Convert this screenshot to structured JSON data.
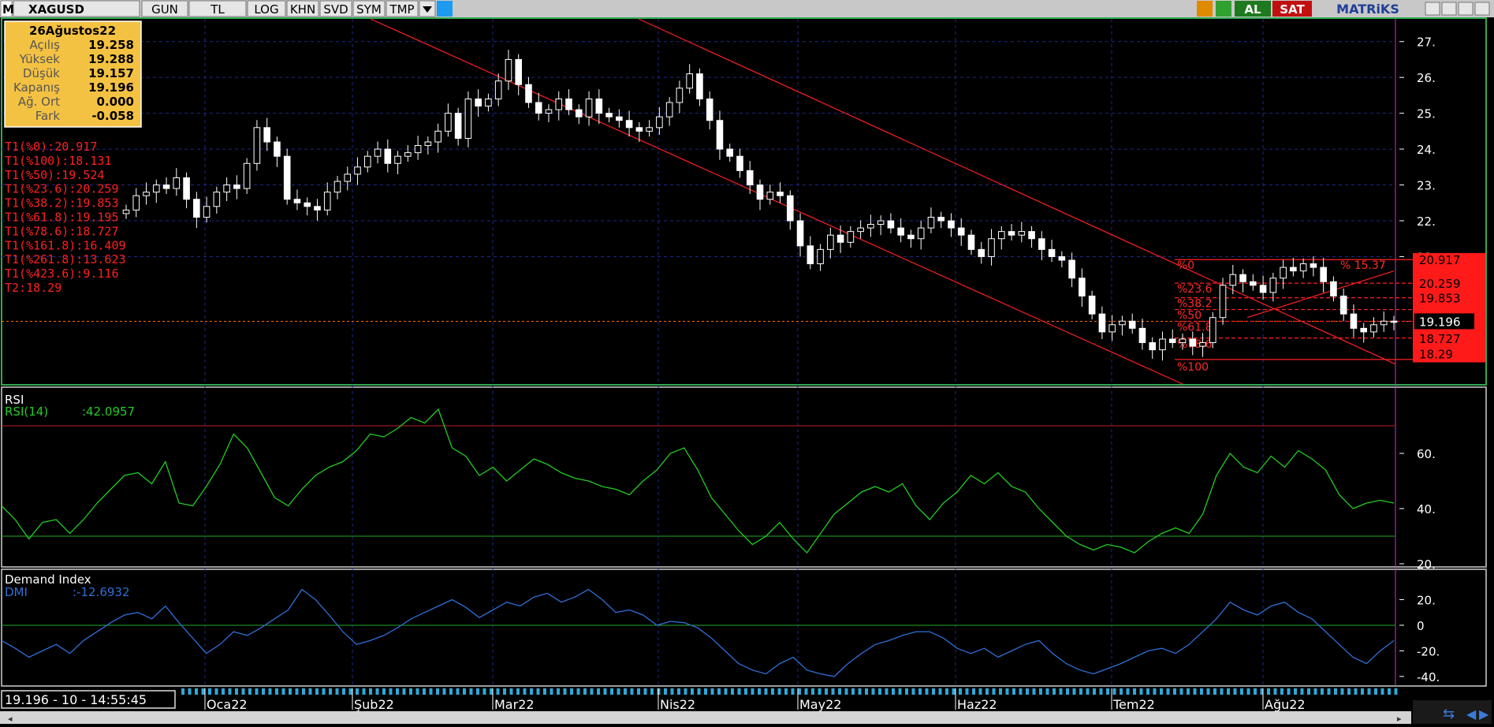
{
  "toolbar": {
    "symbol": "XAGUSD",
    "buttons": [
      "GUN",
      "TL",
      "LOG",
      "KHN",
      "SVD",
      "SYM",
      "TMP"
    ],
    "al": "AL",
    "sat": "SAT",
    "brand": "MATRiKS"
  },
  "ohlc_box": {
    "date": "26Ağustos22",
    "rows": [
      {
        "label": "Açılış",
        "value": "19.258"
      },
      {
        "label": "Yüksek",
        "value": "19.288"
      },
      {
        "label": "Düşük",
        "value": "19.157"
      },
      {
        "label": "Kapanış",
        "value": "19.196"
      },
      {
        "label": "Ağ. Ort",
        "value": "0.000"
      },
      {
        "label": "Fark",
        "value": "-0.058"
      }
    ]
  },
  "fib_legend": [
    "T1(%0):20.917",
    "T1(%100):18.131",
    "T1(%50):19.524",
    "T1(%23.6):20.259",
    "T1(%38.2):19.853",
    "T1(%61.8):19.195",
    "T1(%78.6):18.727",
    "T1(%161.8):16.409",
    "T1(%261.8):13.623",
    "T1(%423.6):9.116",
    "T2:18.29"
  ],
  "status_text": "19.196 - 10 - 14:55:45",
  "colors": {
    "up": "#ffffff",
    "down": "#ffffff",
    "rsi": "#22cc22",
    "dmi": "#2f6fd8",
    "trend": "#ff2020",
    "grid": "#1c2a88"
  },
  "chart_data": [
    {
      "type": "candlestick",
      "symbol": "XAGUSD",
      "y_ticks": [
        "27.",
        "26.",
        "25.",
        "24.",
        "23.",
        "22.",
        "21.",
        "20.917",
        "20.259",
        "19.853",
        "19.196",
        "18.727",
        "18.29"
      ],
      "ylim": [
        17.6,
        27.5
      ],
      "x_labels": [
        "Oca22",
        "Şub22",
        "Mar22",
        "Nis22",
        "May22",
        "Haz22",
        "Tem22",
        "Ağu22"
      ],
      "last_price": "19.196",
      "fib_levels": [
        {
          "label": "%0",
          "value": 20.917
        },
        {
          "label": "%23.6",
          "value": 20.259
        },
        {
          "label": "%38.2",
          "value": 19.853
        },
        {
          "label": "%50",
          "value": 19.524
        },
        {
          "label": "%61.8",
          "value": 19.195
        },
        {
          "label": "%78.6",
          "value": 18.727
        },
        {
          "label": "%100",
          "value": 18.131
        }
      ],
      "fib_annotation": "% 15.37",
      "closes": [
        22.3,
        22.7,
        22.8,
        23.0,
        22.9,
        23.2,
        22.6,
        22.1,
        22.4,
        22.8,
        23.0,
        22.9,
        23.6,
        24.6,
        24.2,
        23.8,
        22.6,
        22.5,
        22.4,
        22.3,
        22.8,
        23.1,
        23.3,
        23.5,
        23.8,
        24.0,
        23.6,
        23.8,
        23.9,
        24.1,
        24.2,
        24.5,
        25.0,
        24.3,
        25.4,
        25.2,
        25.4,
        25.9,
        26.5,
        25.8,
        25.3,
        25.0,
        25.1,
        25.4,
        25.1,
        24.9,
        25.4,
        25.0,
        24.9,
        24.8,
        24.6,
        24.5,
        24.6,
        24.9,
        25.3,
        25.7,
        26.1,
        25.4,
        24.8,
        24.0,
        23.8,
        23.4,
        23.0,
        22.6,
        22.8,
        22.7,
        22.0,
        21.3,
        20.8,
        21.2,
        21.6,
        21.4,
        21.7,
        21.8,
        21.9,
        22.0,
        21.8,
        21.6,
        21.5,
        21.8,
        22.1,
        22.0,
        21.8,
        21.6,
        21.2,
        21.0,
        21.5,
        21.7,
        21.6,
        21.7,
        21.5,
        21.2,
        21.0,
        20.9,
        20.4,
        19.9,
        19.4,
        18.9,
        19.1,
        19.2,
        19.0,
        18.6,
        18.4,
        18.7,
        18.6,
        18.7,
        18.5,
        18.6,
        19.3,
        20.2,
        20.5,
        20.3,
        20.2,
        20.0,
        20.4,
        20.7,
        20.6,
        20.8,
        20.7,
        20.3,
        19.9,
        19.4,
        19.0,
        18.9,
        19.1,
        19.2,
        19.196
      ],
      "trend_channel": [
        {
          "from": [
            0,
            27.6
          ],
          "to": [
            112,
            18.0
          ]
        },
        {
          "from": [
            0,
            27.9
          ],
          "to": [
            125,
            19.0
          ]
        }
      ]
    },
    {
      "type": "line",
      "title": "RSI",
      "series": [
        {
          "name": "RSI(14)",
          "values": [
            41,
            36,
            29,
            35,
            36,
            31,
            36,
            42,
            47,
            52,
            53,
            49,
            57,
            42,
            41,
            48,
            56,
            67,
            62,
            53,
            44,
            41,
            47,
            52,
            55,
            57,
            61,
            67,
            66,
            69,
            73,
            71,
            76,
            62,
            59,
            52,
            55,
            50,
            54,
            58,
            56,
            53,
            51,
            50,
            48,
            47,
            45,
            50,
            54,
            60,
            62,
            54,
            44,
            38,
            32,
            27,
            30,
            35,
            29,
            24,
            31,
            38,
            42,
            46,
            48,
            46,
            49,
            41,
            36,
            42,
            46,
            52,
            49,
            53,
            48,
            46,
            40,
            35,
            30,
            27,
            25,
            27,
            26,
            24,
            28,
            31,
            33,
            31,
            38,
            52,
            60,
            55,
            53,
            59,
            55,
            61,
            58,
            54,
            45,
            40,
            42,
            43,
            42
          ]
        }
      ],
      "value_label": ":42.0957",
      "y_ticks": [
        "60.",
        "40.",
        "20."
      ],
      "ylim": [
        20,
        80
      ],
      "levels": [
        70,
        30
      ]
    },
    {
      "type": "line",
      "title": "Demand Index",
      "series": [
        {
          "name": "DMI",
          "values": [
            -12,
            -18,
            -25,
            -20,
            -15,
            -22,
            -12,
            -5,
            2,
            8,
            10,
            5,
            15,
            2,
            -10,
            -22,
            -15,
            -5,
            -8,
            -2,
            5,
            12,
            28,
            20,
            8,
            -5,
            -15,
            -12,
            -8,
            -2,
            5,
            10,
            15,
            20,
            14,
            6,
            12,
            18,
            15,
            22,
            25,
            18,
            22,
            28,
            20,
            10,
            12,
            8,
            0,
            3,
            2,
            -2,
            -10,
            -20,
            -30,
            -35,
            -38,
            -30,
            -25,
            -35,
            -38,
            -40,
            -30,
            -22,
            -15,
            -12,
            -8,
            -5,
            -5,
            -10,
            -18,
            -22,
            -18,
            -25,
            -20,
            -15,
            -12,
            -22,
            -30,
            -35,
            -38,
            -34,
            -30,
            -25,
            -20,
            -18,
            -22,
            -15,
            -5,
            5,
            18,
            12,
            8,
            15,
            18,
            10,
            5,
            -5,
            -15,
            -25,
            -30,
            -20,
            -12
          ]
        }
      ],
      "value_label": ":-12.6932",
      "y_ticks": [
        "20.",
        "0",
        "-20.",
        "-40."
      ],
      "ylim": [
        -45,
        40
      ],
      "levels": [
        0
      ]
    }
  ]
}
